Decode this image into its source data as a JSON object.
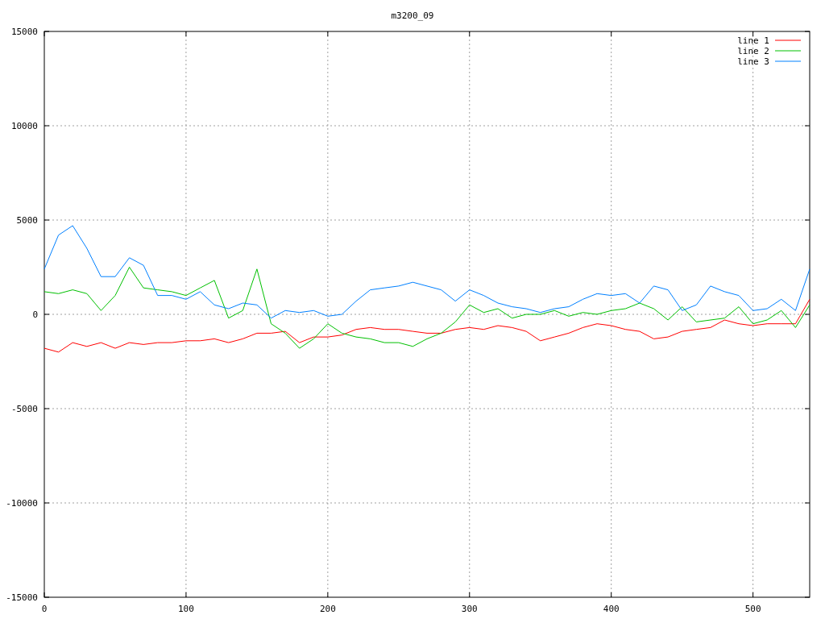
{
  "chart_data": {
    "type": "line",
    "title": "m3200_09",
    "grid": true,
    "legend": true,
    "xlim": [
      0,
      540
    ],
    "ylim": [
      -15000,
      15000
    ],
    "xticks": [
      0,
      100,
      200,
      300,
      400,
      500
    ],
    "yticks": [
      -15000,
      -10000,
      -5000,
      0,
      5000,
      10000,
      15000
    ],
    "x": [
      0,
      10,
      20,
      30,
      40,
      50,
      60,
      70,
      80,
      90,
      100,
      110,
      120,
      130,
      140,
      150,
      160,
      170,
      180,
      190,
      200,
      210,
      220,
      230,
      240,
      250,
      260,
      270,
      280,
      290,
      300,
      310,
      320,
      330,
      340,
      350,
      360,
      370,
      380,
      390,
      400,
      410,
      420,
      430,
      440,
      450,
      460,
      470,
      480,
      490,
      500,
      510,
      520,
      530,
      540
    ],
    "series": [
      {
        "name": "line 1",
        "color": "#ff0000",
        "values": [
          -1800,
          -2000,
          -1500,
          -1700,
          -1500,
          -1800,
          -1500,
          -1600,
          -1500,
          -1500,
          -1400,
          -1400,
          -1300,
          -1500,
          -1300,
          -1000,
          -1000,
          -900,
          -1500,
          -1200,
          -1200,
          -1100,
          -800,
          -700,
          -800,
          -800,
          -900,
          -1000,
          -1000,
          -800,
          -700,
          -800,
          -600,
          -700,
          -900,
          -1400,
          -1200,
          -1000,
          -700,
          -500,
          -600,
          -800,
          -900,
          -1300,
          -1200,
          -900,
          -800,
          -700,
          -300,
          -500,
          -600,
          -500,
          -500,
          -500,
          800
        ]
      },
      {
        "name": "line 2",
        "color": "#00c000",
        "values": [
          1200,
          1100,
          1300,
          1100,
          200,
          1000,
          2500,
          1400,
          1300,
          1200,
          1000,
          1400,
          1800,
          -200,
          200,
          2400,
          -500,
          -1000,
          -1800,
          -1300,
          -500,
          -1000,
          -1200,
          -1300,
          -1500,
          -1500,
          -1700,
          -1300,
          -1000,
          -400,
          500,
          100,
          300,
          -200,
          0,
          0,
          200,
          -100,
          100,
          0,
          200,
          300,
          600,
          300,
          -300,
          400,
          -400,
          -300,
          -200,
          400,
          -500,
          -300,
          200,
          -700,
          500
        ]
      },
      {
        "name": "line 3",
        "color": "#0080ff",
        "values": [
          2400,
          4200,
          4700,
          3500,
          2000,
          2000,
          3000,
          2600,
          1000,
          1000,
          800,
          1200,
          500,
          300,
          600,
          500,
          -200,
          200,
          100,
          200,
          -100,
          0,
          700,
          1300,
          1400,
          1500,
          1700,
          1500,
          1300,
          700,
          1300,
          1000,
          600,
          400,
          300,
          100,
          300,
          400,
          800,
          1100,
          1000,
          1100,
          600,
          1500,
          1300,
          200,
          500,
          1500,
          1200,
          1000,
          200,
          300,
          800,
          200,
          2400
        ]
      }
    ]
  }
}
